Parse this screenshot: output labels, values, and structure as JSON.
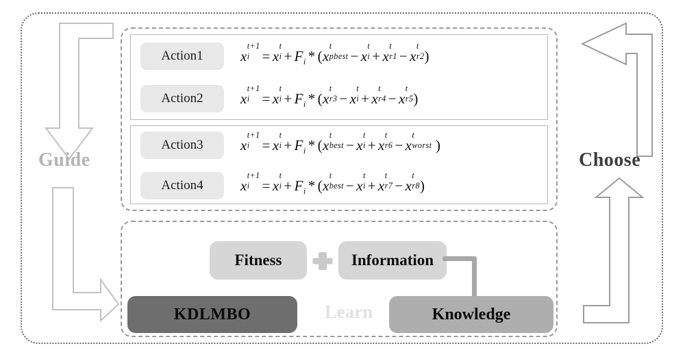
{
  "diagram": {
    "title": "KDLMBO knowledge-driven learning framework",
    "labels": {
      "guide": "Guide",
      "choose": "Choose",
      "learn": "Learn"
    },
    "colors": {
      "outer_border": "#6b6b6b",
      "dashed_border": "#9a9a9a",
      "panel_border": "#b9b9b9",
      "chip_bg": "#e8e8e8",
      "light_box_bg": "#d6d6d6",
      "medium_box_bg": "#aeaeae",
      "dark_box_bg": "#6e6e6e",
      "learn_text": "#e2e2e2",
      "guide_text": "#b4b4b4",
      "choose_text": "#3d3d3d",
      "connector": "#a8a8a8",
      "arrow_stroke": "#c2c2c2"
    },
    "actions": [
      {
        "id": "action1",
        "label": "Action1",
        "formula_text": "x_i^{t+1} = x_i^t + F_i * (x_{pbest}^t - x_i^t + x_{r1}^t - x_{r2}^t)",
        "lhs_var": "x",
        "lhs_sub": "i",
        "lhs_sup": "t+1",
        "terms": [
          "x_i^t",
          "F_i",
          "x_pbest^t",
          "x_i^t",
          "x_r1^t",
          "x_r2^t"
        ],
        "subs": [
          "pbest",
          "r1",
          "r2"
        ]
      },
      {
        "id": "action2",
        "label": "Action2",
        "formula_text": "x_i^{t+1} = x_i^t + F_i * (x_{r3}^t - x_i^t + x_{r4}^t - x_{r5}^t)",
        "lhs_var": "x",
        "lhs_sub": "i",
        "lhs_sup": "t+1",
        "terms": [
          "x_i^t",
          "F_i",
          "x_r3^t",
          "x_i^t",
          "x_r4^t",
          "x_r5^t"
        ],
        "subs": [
          "r3",
          "r4",
          "r5"
        ]
      },
      {
        "id": "action3",
        "label": "Action3",
        "formula_text": "x_i^{t+1} = x_i^t + F_i * (x_{best}^t - x_i^t + x_{r6}^t - x_{worst}^t )",
        "lhs_var": "x",
        "lhs_sub": "i",
        "lhs_sup": "t+1",
        "terms": [
          "x_i^t",
          "F_i",
          "x_best^t",
          "x_i^t",
          "x_r6^t",
          "x_worst^t"
        ],
        "subs": [
          "best",
          "r6",
          "worst"
        ]
      },
      {
        "id": "action4",
        "label": "Action4",
        "formula_text": "x_i^{t+1} = x_i^t + F_i * (x_{best}^t - x_i^t + x_{r7}^t - x_{r8}^t)",
        "lhs_var": "x",
        "lhs_sub": "i",
        "lhs_sup": "t+1",
        "terms": [
          "x_i^t",
          "F_i",
          "x_best^t",
          "x_i^t",
          "x_r7^t",
          "x_r8^t"
        ],
        "subs": [
          "best",
          "r7",
          "r8"
        ]
      }
    ],
    "learn_section": {
      "fitness": "Fitness",
      "plus": "+",
      "information": "Information",
      "kdlmbo": "KDLMBO",
      "knowledge": "Knowledge"
    },
    "arrows": [
      {
        "name": "guide-arrow-down",
        "direction": "down",
        "shape": "L-shaped"
      },
      {
        "name": "guide-arrow-right",
        "direction": "right",
        "shape": "L-shaped"
      },
      {
        "name": "choose-arrow-left",
        "direction": "left",
        "shape": "L-shaped"
      },
      {
        "name": "choose-arrow-up",
        "direction": "up",
        "shape": "L-shaped"
      }
    ]
  }
}
